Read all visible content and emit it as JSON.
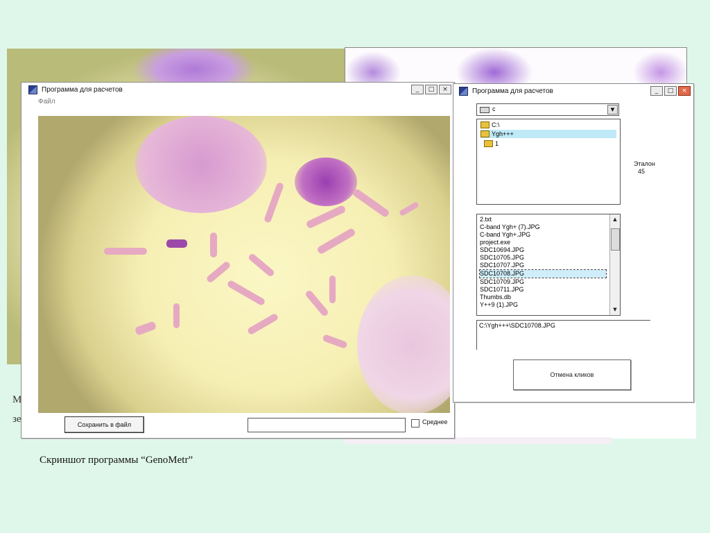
{
  "window_left": {
    "title": "Программа для расчетов",
    "menu_file": "Файл",
    "save_button": "Сохранить в файл",
    "avg_label": "Среднее",
    "buttons": {
      "minimize": "_",
      "maximize": "□",
      "close": "×"
    }
  },
  "window_right": {
    "title": "Программа для расчетов",
    "drive": "c",
    "drive_arrow": "▼",
    "directories": [
      "C:\\",
      "Ygh+++",
      "1"
    ],
    "etalon_label": "Эталон",
    "etalon_value": "45",
    "files": [
      "2.txt",
      "C-band Ygh+ (7).JPG",
      "C-band Ygh+.JPG",
      "project.exe",
      "SDC10694.JPG",
      "SDC10705.JPG",
      "SDC10707.JPG",
      "SDC10708.JPG",
      "SDC10709.JPG",
      "SDC10711.JPG",
      "Thumbs.db",
      "Y++9 (1).JPG"
    ],
    "selected_file_index": 7,
    "path": "C:\\Ygh+++\\SDC10708.JPG",
    "cancel_button": "Отмена кликов",
    "buttons": {
      "minimize": "_",
      "maximize": "□",
      "close": "×"
    },
    "scroll_up": "▲",
    "scroll_down": "▼"
  },
  "behind_text": {
    "line1": "М",
    "line2": "зе"
  },
  "caption": "Скриншот программы “GenoMetr”"
}
